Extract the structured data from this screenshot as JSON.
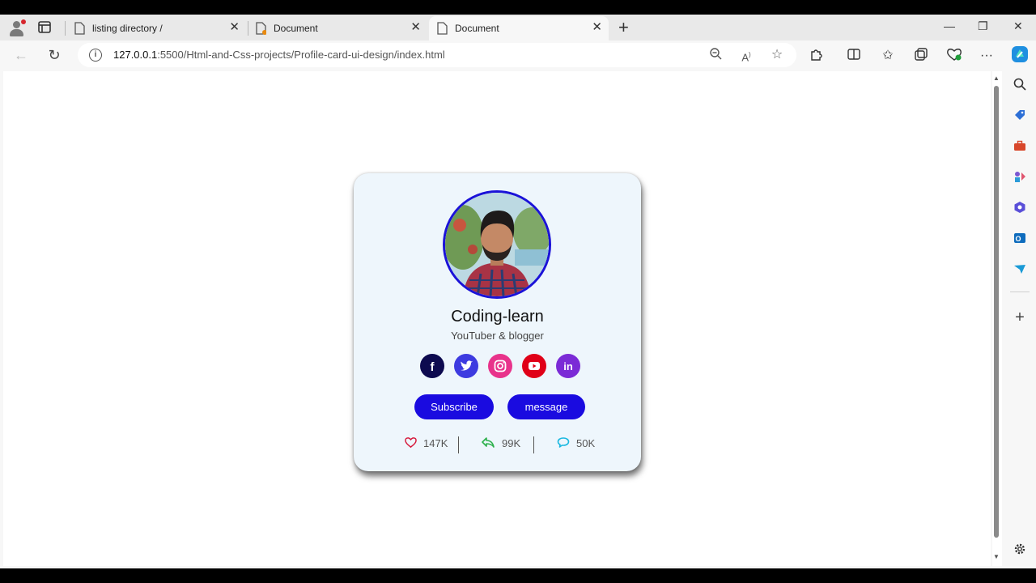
{
  "tabs": [
    {
      "title": "listing directory /",
      "active": false
    },
    {
      "title": "Document",
      "active": false
    },
    {
      "title": "Document",
      "active": true
    }
  ],
  "address_bar": {
    "url_host": "127.0.0.1",
    "url_rest": ":5500/Html-and-Css-projects/Profile-card-ui-design/index.html"
  },
  "card": {
    "name": "Coding-learn",
    "role": "YouTuber & blogger",
    "social": [
      {
        "icon": "facebook-icon",
        "glyph": "f",
        "color": "#0d0a4f"
      },
      {
        "icon": "twitter-icon",
        "glyph": "",
        "color": "#3d3be0"
      },
      {
        "icon": "instagram-icon",
        "glyph": "",
        "color": "#e8338b"
      },
      {
        "icon": "youtube-icon",
        "glyph": "",
        "color": "#e00018"
      },
      {
        "icon": "linkedin-icon",
        "glyph": "in",
        "color": "#7b2bd6"
      }
    ],
    "buttons": {
      "subscribe": "Subscribe",
      "message": "message"
    },
    "stats": [
      {
        "icon": "heart-icon",
        "value": "147K",
        "color": "#d61a3c"
      },
      {
        "icon": "share-icon",
        "value": "99K",
        "color": "#2db04c"
      },
      {
        "icon": "comment-icon",
        "value": "50K",
        "color": "#1ab8e0"
      }
    ],
    "accent_color": "#1a0be0",
    "background_color": "#eef6fc"
  }
}
